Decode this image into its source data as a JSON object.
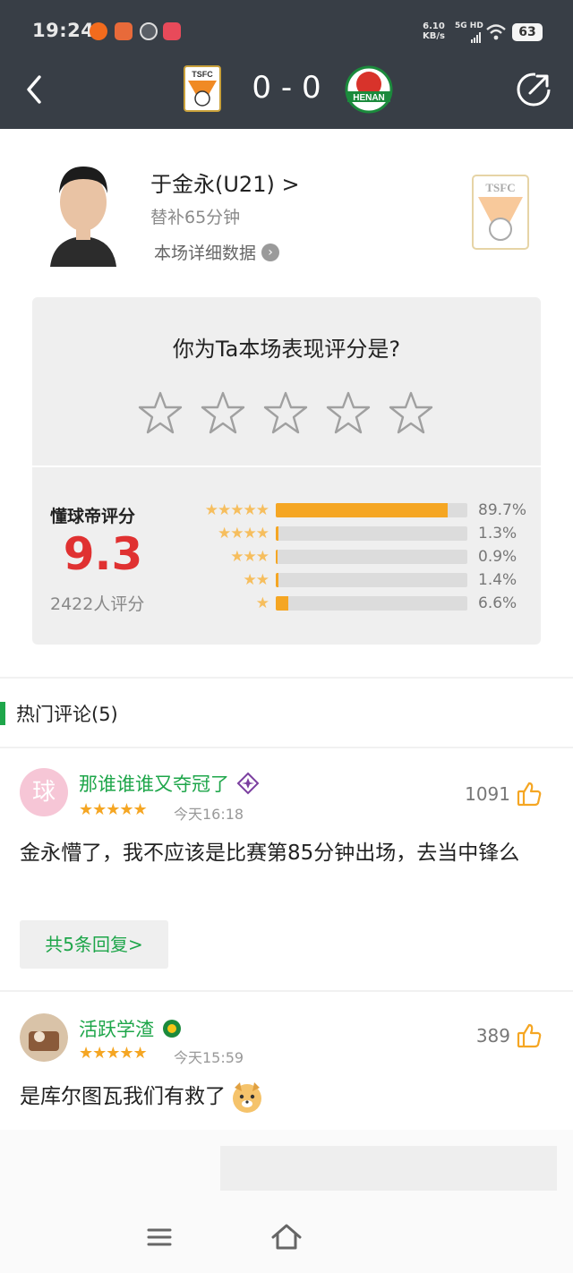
{
  "status_bar": {
    "time": "19:24",
    "net_speed": "6.10",
    "net_unit": "KB/s",
    "signal": "5G HD",
    "battery": "63"
  },
  "match": {
    "score": "0 - 0",
    "home_team_abbr": "TSFC",
    "away_team_name": "HENAN",
    "colors": {
      "home": "#f08a24",
      "away": "#1b8a3c",
      "header_bg": "#383e46"
    }
  },
  "player": {
    "name": "于金永(U21)",
    "name_chevron": ">",
    "status": "替补65分钟",
    "detail_link": "本场详细数据",
    "club_badge_text": "TSFC"
  },
  "rating_prompt": {
    "question": "你为Ta本场表现评分是?",
    "star_count": 5
  },
  "rating_stats": {
    "label": "懂球帝评分",
    "score": "9.3",
    "count": "2422人评分",
    "distribution": [
      {
        "stars": "★★★★★",
        "percent": 89.7,
        "label": "89.7%"
      },
      {
        "stars": "★★★★",
        "percent": 1.3,
        "label": "1.3%"
      },
      {
        "stars": "★★★",
        "percent": 0.9,
        "label": "0.9%"
      },
      {
        "stars": "★★",
        "percent": 1.4,
        "label": "1.4%"
      },
      {
        "stars": "★",
        "percent": 6.6,
        "label": "6.6%"
      }
    ]
  },
  "comments_section": {
    "title": "热门评论(5)",
    "accent": "#1ea64a"
  },
  "comments": [
    {
      "avatar_char": "球",
      "username": "那谁谁谁又夺冠了",
      "stars": "★★★★★",
      "time": "今天16:18",
      "likes": "1091",
      "text": "金永懵了，我不应该是比赛第85分钟出场，去当中锋么",
      "reply_label": "共5条回复>"
    },
    {
      "username": "活跃学渣",
      "stars": "★★★★★",
      "time": "今天15:59",
      "likes": "389",
      "text": "是库尔图瓦我们有救了"
    }
  ]
}
